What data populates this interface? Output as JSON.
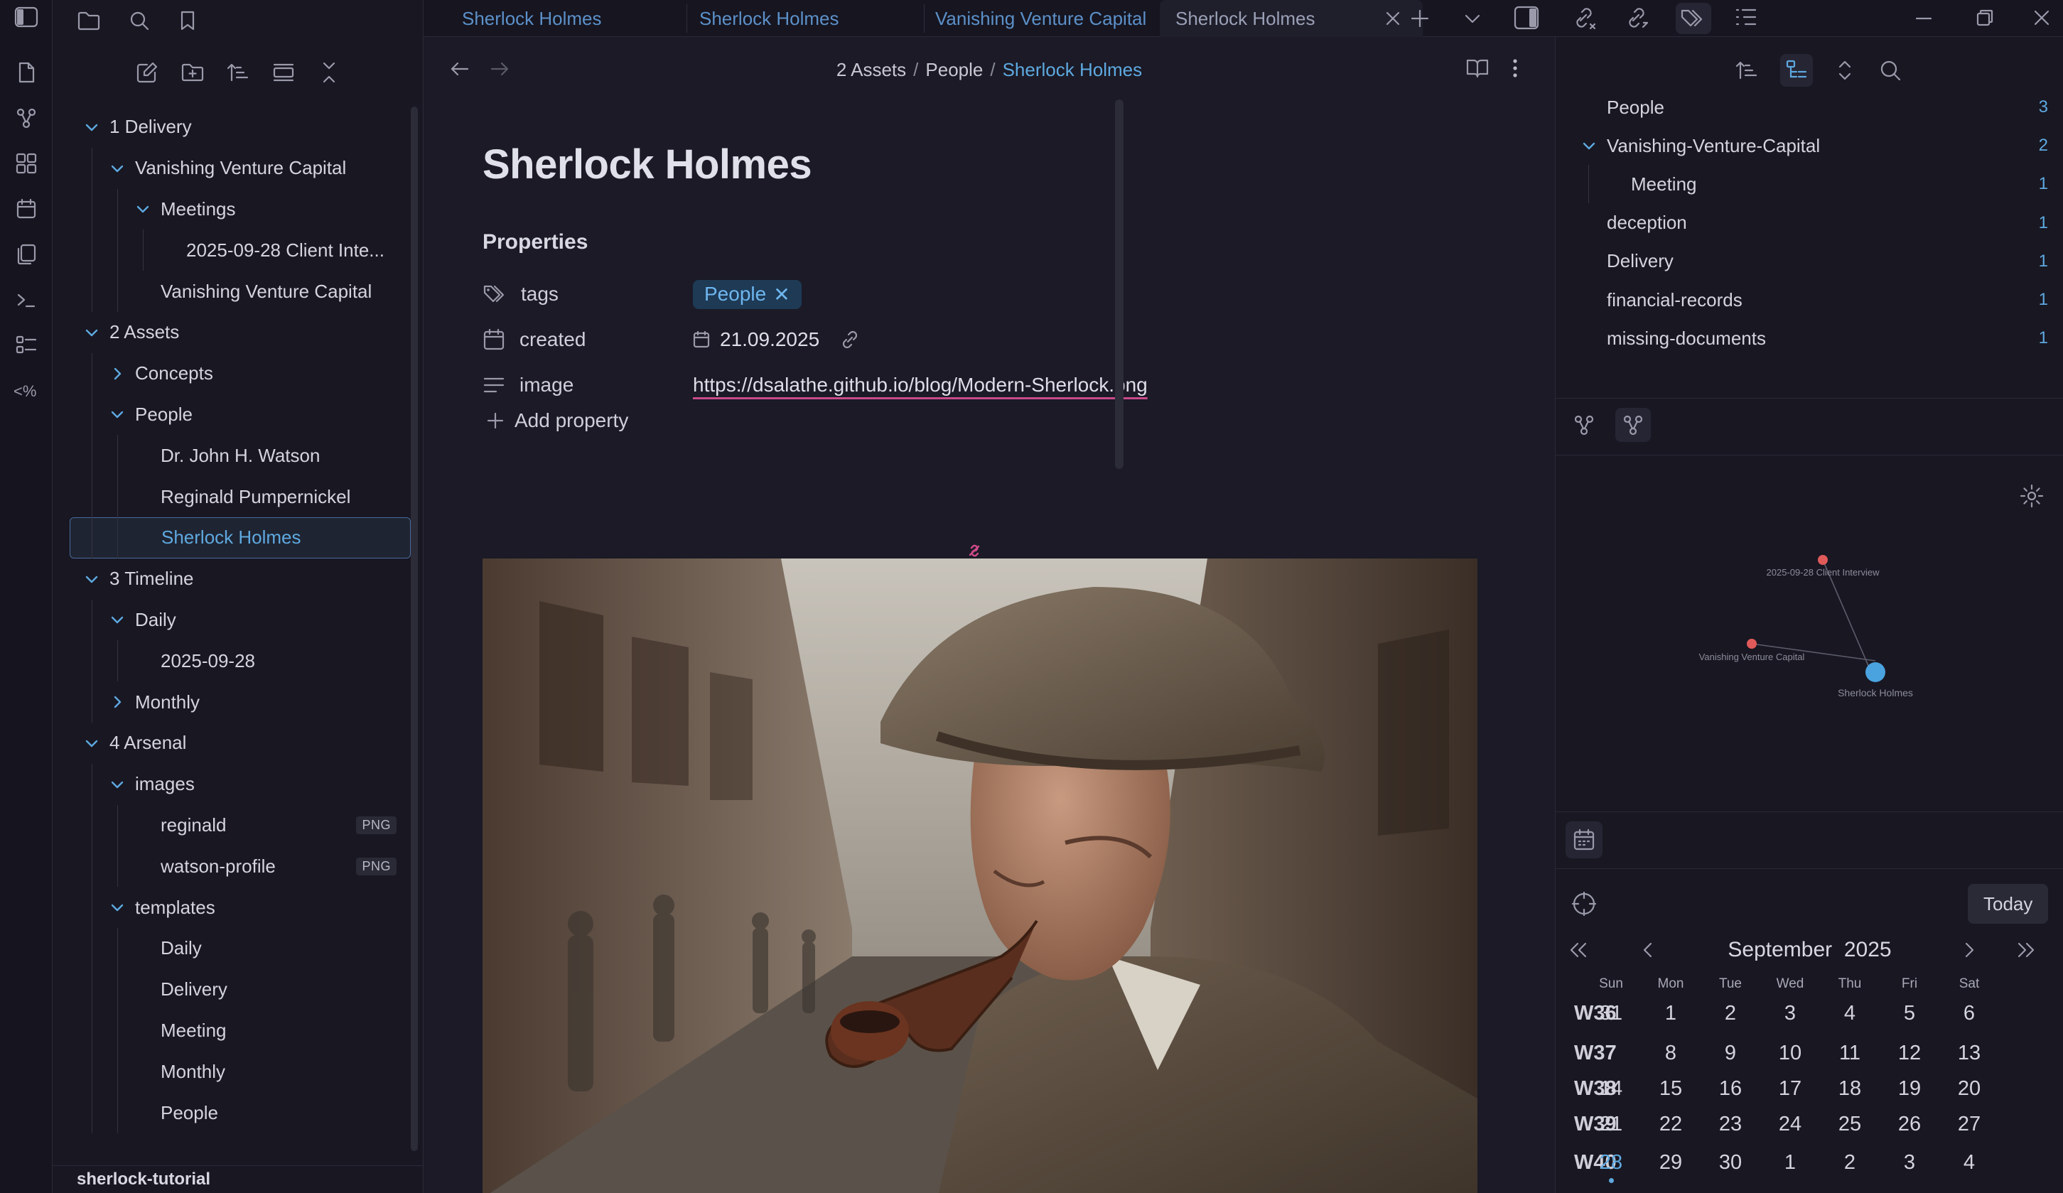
{
  "tabs": [
    {
      "label": "Sherlock Holmes"
    },
    {
      "label": "Sherlock Holmes"
    },
    {
      "label": "Vanishing Venture Capital"
    },
    {
      "label": "Sherlock Holmes"
    }
  ],
  "breadcrumb": {
    "part1": "2 Assets",
    "part2": "People",
    "current": "Sherlock Holmes"
  },
  "file_tree": [
    {
      "label": "1 Delivery",
      "depth": 0,
      "chevron": "down"
    },
    {
      "label": "Vanishing Venture Capital",
      "depth": 1,
      "chevron": "down"
    },
    {
      "label": "Meetings",
      "depth": 2,
      "chevron": "down"
    },
    {
      "label": "2025-09-28 Client Inte...",
      "depth": 3,
      "chevron": "none"
    },
    {
      "label": "Vanishing Venture Capital",
      "depth": 2,
      "chevron": "none"
    },
    {
      "label": "2 Assets",
      "depth": 0,
      "chevron": "down"
    },
    {
      "label": "Concepts",
      "depth": 1,
      "chevron": "right"
    },
    {
      "label": "People",
      "depth": 1,
      "chevron": "down"
    },
    {
      "label": "Dr. John H. Watson",
      "depth": 2,
      "chevron": "none"
    },
    {
      "label": "Reginald Pumpernickel",
      "depth": 2,
      "chevron": "none"
    },
    {
      "label": "Sherlock Holmes",
      "depth": 2,
      "chevron": "none",
      "active": true
    },
    {
      "label": "3 Timeline",
      "depth": 0,
      "chevron": "down"
    },
    {
      "label": "Daily",
      "depth": 1,
      "chevron": "down"
    },
    {
      "label": "2025-09-28",
      "depth": 2,
      "chevron": "none"
    },
    {
      "label": "Monthly",
      "depth": 1,
      "chevron": "right"
    },
    {
      "label": "4 Arsenal",
      "depth": 0,
      "chevron": "down"
    },
    {
      "label": "images",
      "depth": 1,
      "chevron": "down"
    },
    {
      "label": "reginald",
      "depth": 2,
      "chevron": "none",
      "badge": "PNG"
    },
    {
      "label": "watson-profile",
      "depth": 2,
      "chevron": "none",
      "badge": "PNG"
    },
    {
      "label": "templates",
      "depth": 1,
      "chevron": "down"
    },
    {
      "label": "Daily",
      "depth": 2,
      "chevron": "none"
    },
    {
      "label": "Delivery",
      "depth": 2,
      "chevron": "none"
    },
    {
      "label": "Meeting",
      "depth": 2,
      "chevron": "none"
    },
    {
      "label": "Monthly",
      "depth": 2,
      "chevron": "none"
    },
    {
      "label": "People",
      "depth": 2,
      "chevron": "none"
    }
  ],
  "vault": {
    "name": "sherlock-tutorial"
  },
  "note": {
    "title": "Sherlock Holmes",
    "properties_heading": "Properties",
    "properties": {
      "tags": {
        "key": "tags",
        "value": "People",
        "remove": "✕"
      },
      "created": {
        "key": "created",
        "value": "21.09.2025"
      },
      "image": {
        "key": "image",
        "value": "https://dsalathe.github.io/blog/Modern-Sherlock.png"
      }
    },
    "add_property": "Add property"
  },
  "tag_pane": [
    {
      "label": "People",
      "count": "3",
      "indent": 0,
      "chevron": "none"
    },
    {
      "label": "Vanishing-Venture-Capital",
      "count": "2",
      "indent": 0,
      "chevron": "down"
    },
    {
      "label": "Meeting",
      "count": "1",
      "indent": 1,
      "chevron": "none"
    },
    {
      "label": "deception",
      "count": "1",
      "indent": 0,
      "chevron": "none"
    },
    {
      "label": "Delivery",
      "count": "1",
      "indent": 0,
      "chevron": "none"
    },
    {
      "label": "financial-records",
      "count": "1",
      "indent": 0,
      "chevron": "none"
    },
    {
      "label": "missing-documents",
      "count": "1",
      "indent": 0,
      "chevron": "none"
    }
  ],
  "graph": {
    "nodes": [
      {
        "label": "2025-09-28 Client Interview",
        "color": "#e05a5a",
        "current": false
      },
      {
        "label": "Vanishing Venture Capital",
        "color": "#e05a5a",
        "current": false
      },
      {
        "label": "Sherlock Holmes",
        "color": "#4aa3df",
        "current": true
      }
    ]
  },
  "calendar": {
    "today_label": "Today",
    "month": "September",
    "year": "2025",
    "weekdays": [
      "Sun",
      "Mon",
      "Tue",
      "Wed",
      "Thu",
      "Fri",
      "Sat"
    ],
    "weeks": [
      {
        "label": "W36",
        "days": [
          "31",
          "1",
          "2",
          "3",
          "4",
          "5",
          "6"
        ]
      },
      {
        "label": "W37",
        "days": [
          "7",
          "8",
          "9",
          "10",
          "11",
          "12",
          "13"
        ]
      },
      {
        "label": "W38",
        "days": [
          "14",
          "15",
          "16",
          "17",
          "18",
          "19",
          "20"
        ]
      },
      {
        "label": "W39",
        "days": [
          "21",
          "22",
          "23",
          "24",
          "25",
          "26",
          "27"
        ]
      },
      {
        "label": "W40",
        "days": [
          "28",
          "29",
          "30",
          "1",
          "2",
          "3",
          "4"
        ]
      }
    ],
    "today_date": "28"
  },
  "colors": {
    "accent": "#5ea9e0",
    "bg": "#1b1a26",
    "tag_bg": "#1e3a55",
    "link_underline": "#c84a8a"
  }
}
